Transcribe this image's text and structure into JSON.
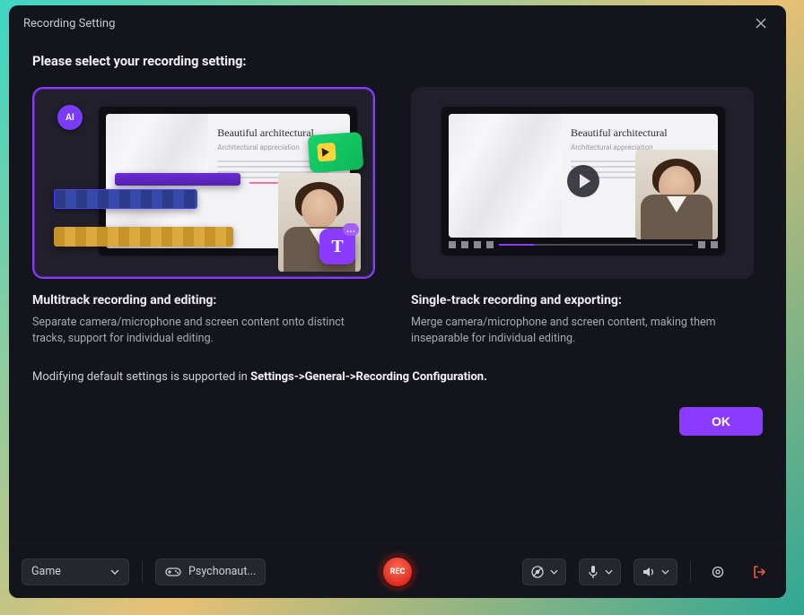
{
  "window": {
    "title": "Recording Setting"
  },
  "heading": "Please select your recording setting:",
  "options": [
    {
      "id": "multitrack",
      "selected": true,
      "title": "Multitrack recording and editing:",
      "description": "Separate camera/microphone and screen content onto distinct tracks, support for individual editing.",
      "mock": {
        "screen_title": "Beautiful architectural",
        "screen_subtitle": "Architectural appreciation",
        "ai_badge": "AI",
        "t_widget": "T"
      }
    },
    {
      "id": "singletrack",
      "selected": false,
      "title": "Single-track recording and exporting:",
      "description": "Merge camera/microphone and screen content, making them inseparable for individual editing.",
      "mock": {
        "screen_title": "Beautiful architectural",
        "screen_subtitle": "Architectural appreciation"
      }
    }
  ],
  "note_prefix": "Modifying default settings is supported in ",
  "note_path": "Settings->General->Recording Configuration.",
  "ok_label": "OK",
  "bottombar": {
    "mode_select": "Game",
    "game_name": "Psychonaut...",
    "rec_label": "REC"
  }
}
